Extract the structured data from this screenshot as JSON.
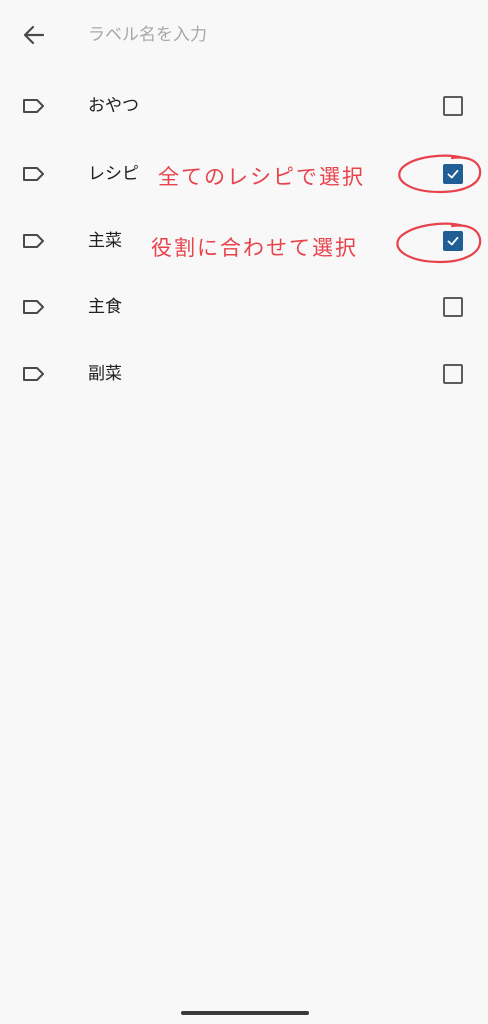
{
  "search": {
    "placeholder": "ラベル名を入力",
    "value": ""
  },
  "labels": [
    {
      "label": "おやつ",
      "checked": false
    },
    {
      "label": "レシピ",
      "checked": true
    },
    {
      "label": "主菜",
      "checked": true
    },
    {
      "label": "主食",
      "checked": false
    },
    {
      "label": "副菜",
      "checked": false
    }
  ],
  "annotations": {
    "recipe_note": "全てのレシピで選択",
    "role_note": "役割に合わせて選択"
  },
  "colors": {
    "background": "#f8f8f8",
    "checkbox_checked": "#1f5f96",
    "annotation": "#e8434c"
  },
  "icons": {
    "back": "arrow-left-icon",
    "label": "label-tag-icon",
    "check": "checkmark-icon"
  }
}
